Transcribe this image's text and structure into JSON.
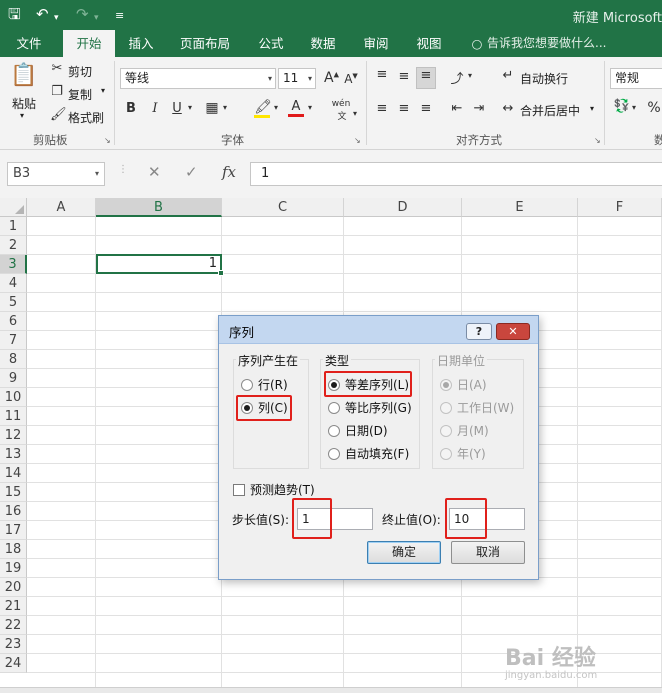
{
  "titlebar": {
    "title": "新建 Microsoft",
    "save_icon": "save-icon",
    "undo_icon": "undo-icon",
    "redo_icon": "redo-icon",
    "customize_icon": "customize-icon"
  },
  "tabs": {
    "file": "文件",
    "home": "开始",
    "insert": "插入",
    "page_layout": "页面布局",
    "formulas": "公式",
    "data": "数据",
    "review": "审阅",
    "view": "视图",
    "tell_me": "告诉我您想要做什么..."
  },
  "ribbon": {
    "clipboard": {
      "paste": "粘贴",
      "cut": "剪切",
      "copy": "复制",
      "format_painter": "格式刷",
      "group": "剪贴板"
    },
    "font": {
      "name": "等线",
      "size": "11",
      "bold": "B",
      "italic": "I",
      "underline": "U",
      "group": "字体",
      "phonetic": "wén"
    },
    "alignment": {
      "wrap_text": "自动换行",
      "merge_center": "合并后居中",
      "group": "对齐方式"
    },
    "number": {
      "format": "常规",
      "group_partial": "数"
    }
  },
  "formula_bar": {
    "name_box": "B3",
    "cancel": "✕",
    "enter": "✓",
    "fx": "fx",
    "value": "1"
  },
  "grid": {
    "columns": [
      "A",
      "B",
      "C",
      "D",
      "E",
      "F"
    ],
    "rows": [
      "1",
      "2",
      "3",
      "4",
      "5",
      "6",
      "7",
      "8",
      "9",
      "10",
      "11",
      "12",
      "13",
      "14",
      "15",
      "16",
      "17",
      "18",
      "19",
      "20",
      "21",
      "22",
      "23",
      "24"
    ],
    "active_cell_value": "1"
  },
  "dialog": {
    "title": "序列",
    "help": "?",
    "close": "✕",
    "series_in": {
      "label": "序列产生在",
      "row": "行(R)",
      "column": "列(C)",
      "selected": "column"
    },
    "type": {
      "label": "类型",
      "linear": "等差序列(L)",
      "growth": "等比序列(G)",
      "date": "日期(D)",
      "autofill": "自动填充(F)",
      "selected": "linear"
    },
    "date_unit": {
      "label": "日期单位",
      "day": "日(A)",
      "weekday": "工作日(W)",
      "month": "月(M)",
      "year": "年(Y)",
      "selected": "day"
    },
    "trend": "预测趋势(T)",
    "step_label": "步长值(S):",
    "step_value": "1",
    "stop_label": "终止值(O):",
    "stop_value": "10",
    "ok": "确定",
    "cancel": "取消"
  },
  "watermark": {
    "text": "Bai 经验",
    "sub": "jingyan.baidu.com"
  }
}
